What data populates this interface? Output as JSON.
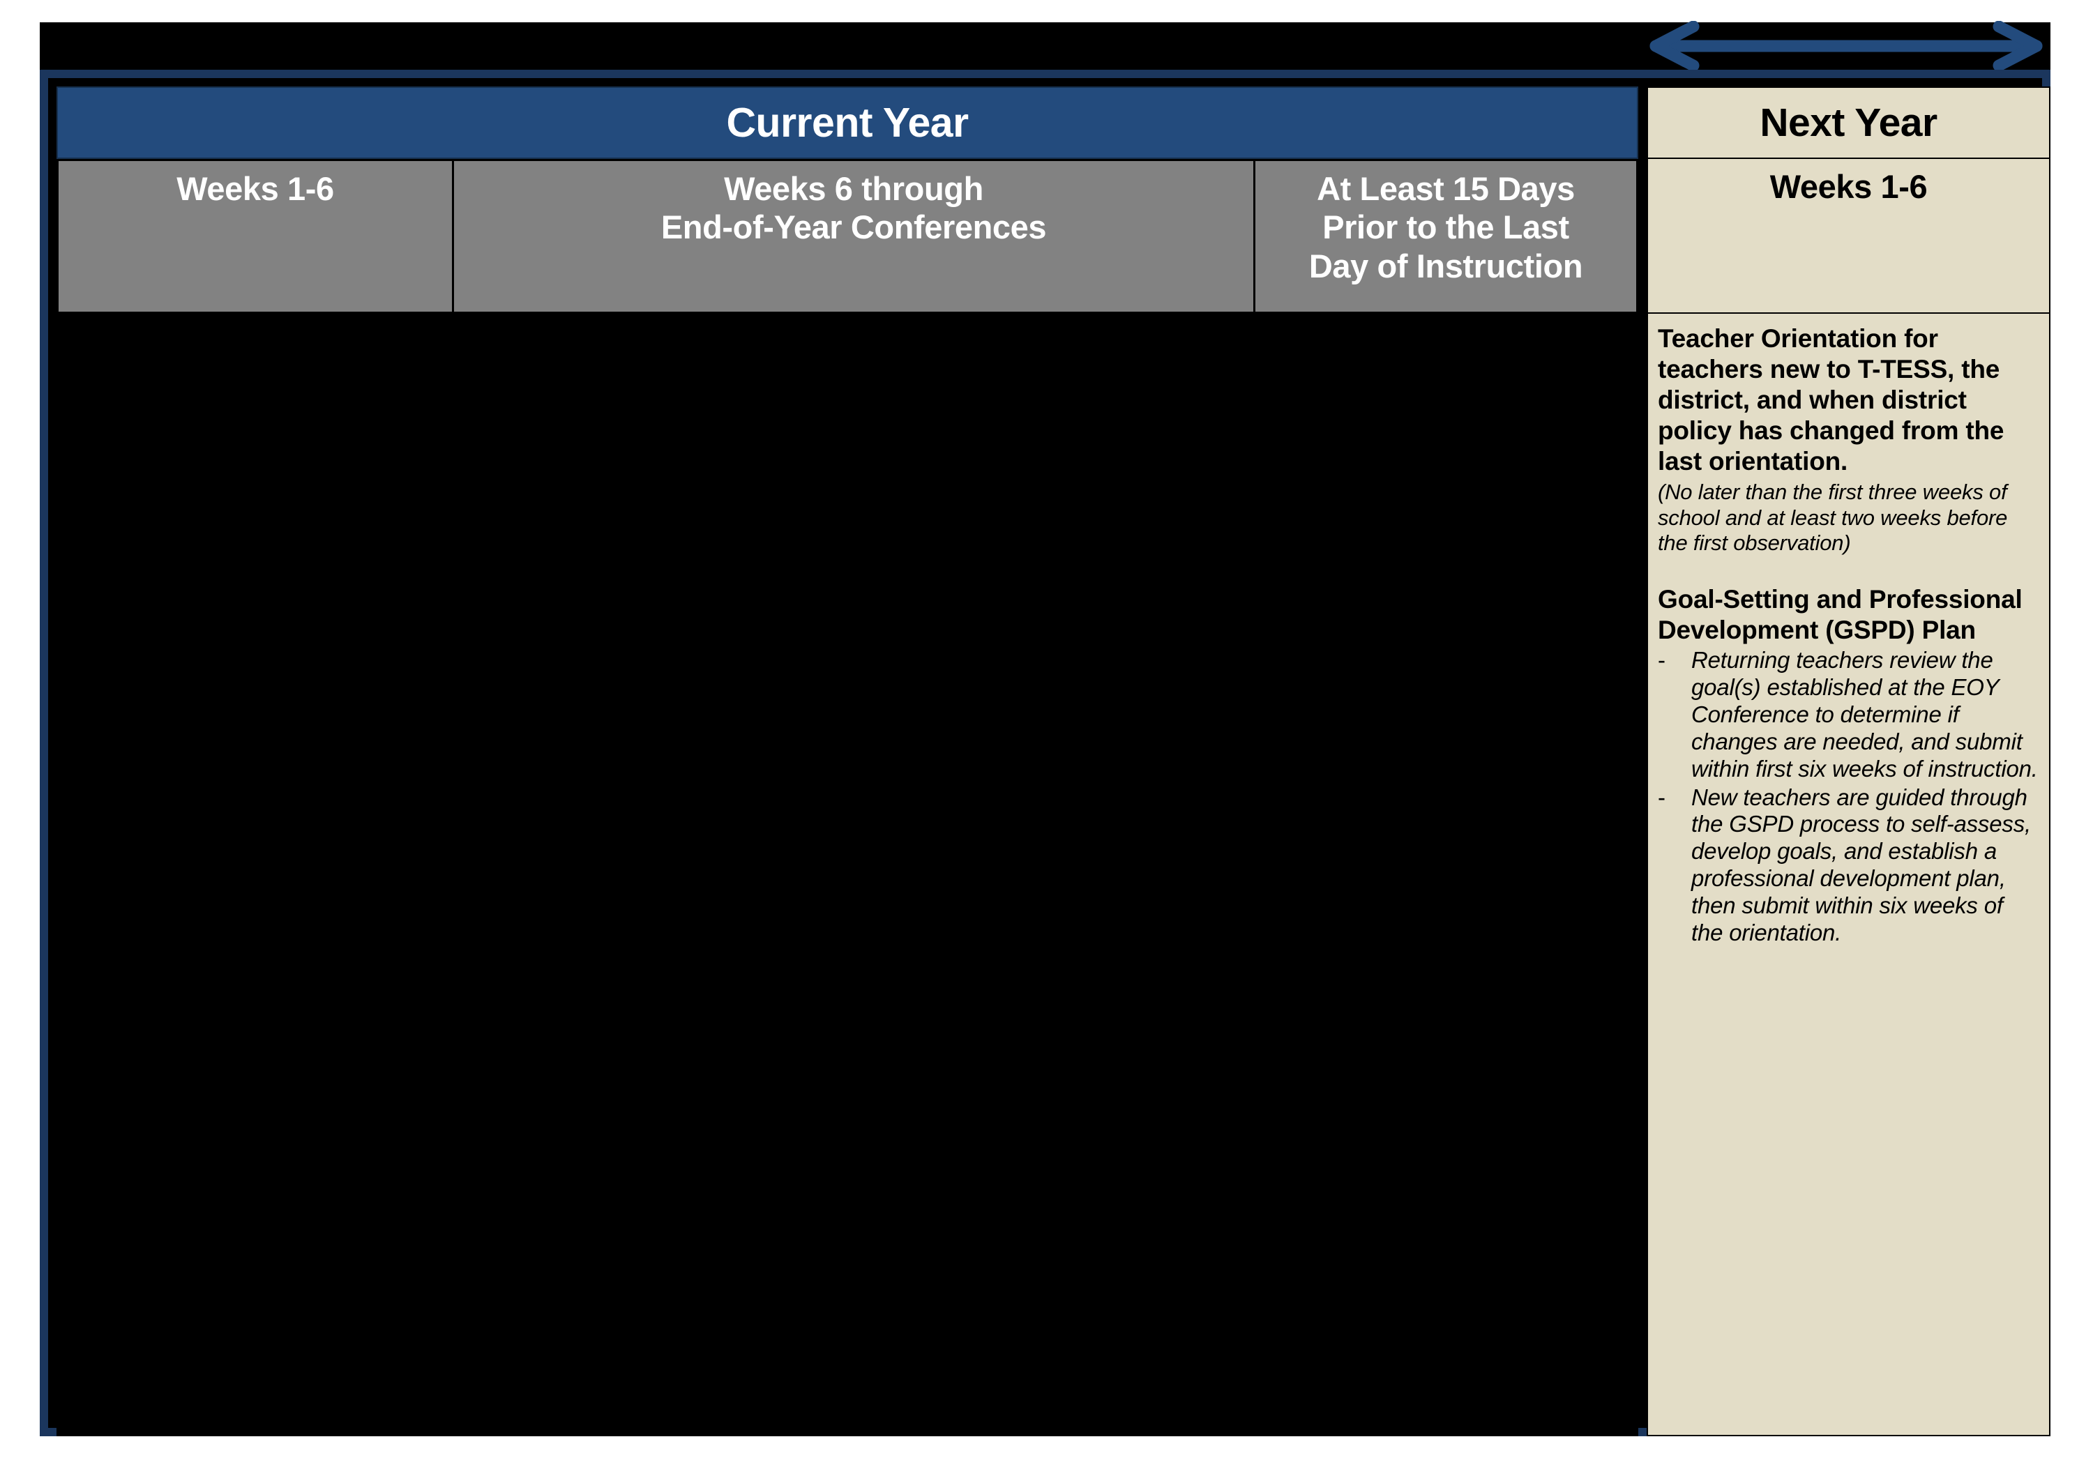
{
  "arrow": {
    "name": "double-headed-arrow",
    "color": "#234b7d"
  },
  "colors": {
    "header_blue": "#234b7d",
    "border_navy": "#1b365d",
    "subheader_gray": "#828282",
    "next_year_beige": "#e3ddc7",
    "body_black": "#000000"
  },
  "table": {
    "year_headers": [
      {
        "label": "Current Year"
      },
      {
        "label": "Next Year"
      }
    ],
    "current_year_phases": [
      {
        "label": "Weeks 1-6"
      },
      {
        "label_line1": "Weeks 6  through",
        "label_line2": "End-of-Year Conferences"
      },
      {
        "label_line1": "At Least 15 Days",
        "label_line2": "Prior to the Last",
        "label_line3": "Day of Instruction"
      }
    ],
    "next_year_phase": {
      "label": "Weeks 1-6"
    },
    "next_year_content": {
      "heading_1": "Teacher Orientation for teachers new to T-TESS, the district, and when district policy has changed from the last orientation.",
      "note_1": "(No later than the first three weeks of school and at least two weeks before the first observation)",
      "heading_2": "Goal-Setting and Professional Development (GSPD) Plan",
      "bullets": [
        {
          "marker": "-",
          "text": "Returning teachers review the goal(s) established at the EOY Conference to determine if changes are needed, and submit within first six weeks of instruction."
        },
        {
          "marker": "-",
          "text": "New teachers are guided through the GSPD process to self-assess, develop goals, and establish a professional development plan, then submit within six weeks of the orientation."
        }
      ]
    }
  }
}
